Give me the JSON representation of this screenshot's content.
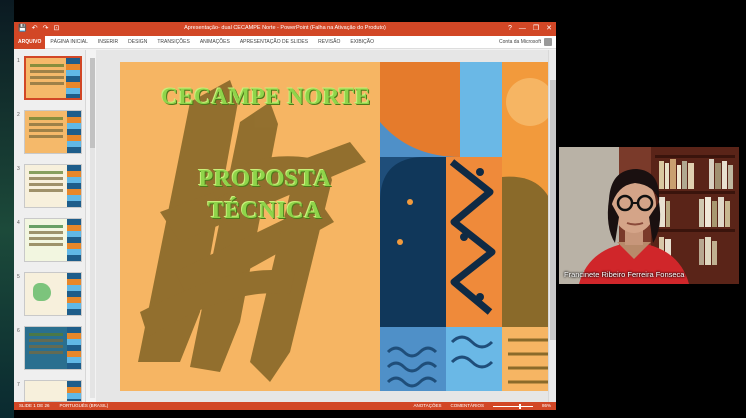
{
  "window": {
    "title": "Apresentação- dual CECAMPE Norte - PowerPoint (Falha na Ativação do Produto)",
    "qat": [
      "💾",
      "↶",
      "↷",
      "⊡"
    ],
    "controls": [
      "?",
      "—",
      "❐",
      "✕"
    ]
  },
  "ribbon": {
    "file_tab": "ARQUIVO",
    "tabs": [
      "PÁGINA INICIAL",
      "INSERIR",
      "DESIGN",
      "TRANSIÇÕES",
      "ANIMAÇÕES",
      "APRESENTAÇÃO DE SLIDES",
      "REVISÃO",
      "EXIBIÇÃO"
    ],
    "account": "Conta da Microsoft"
  },
  "thumbnails": {
    "numbers": [
      "1",
      "2",
      "3",
      "4",
      "5",
      "6",
      "7"
    ],
    "selected": "1"
  },
  "slide": {
    "title": "CECAMPE NORTE",
    "subtitle_line1": "PROPOSTA",
    "subtitle_line2": "TÉCNICA"
  },
  "status": {
    "slide_indicator": "SLIDE 1 DE 26",
    "language": "PORTUGUÊS (BRASIL)",
    "notes": "ANOTAÇÕES",
    "comments": "COMENTÁRIOS",
    "zoom": "86%"
  },
  "webcam": {
    "participant_name": "Francinete Ribeiro Ferreira Fonseca"
  },
  "colors": {
    "ppt_accent": "#d24726",
    "slide_background": "#f6b563",
    "title_green": "#8fd44a"
  }
}
